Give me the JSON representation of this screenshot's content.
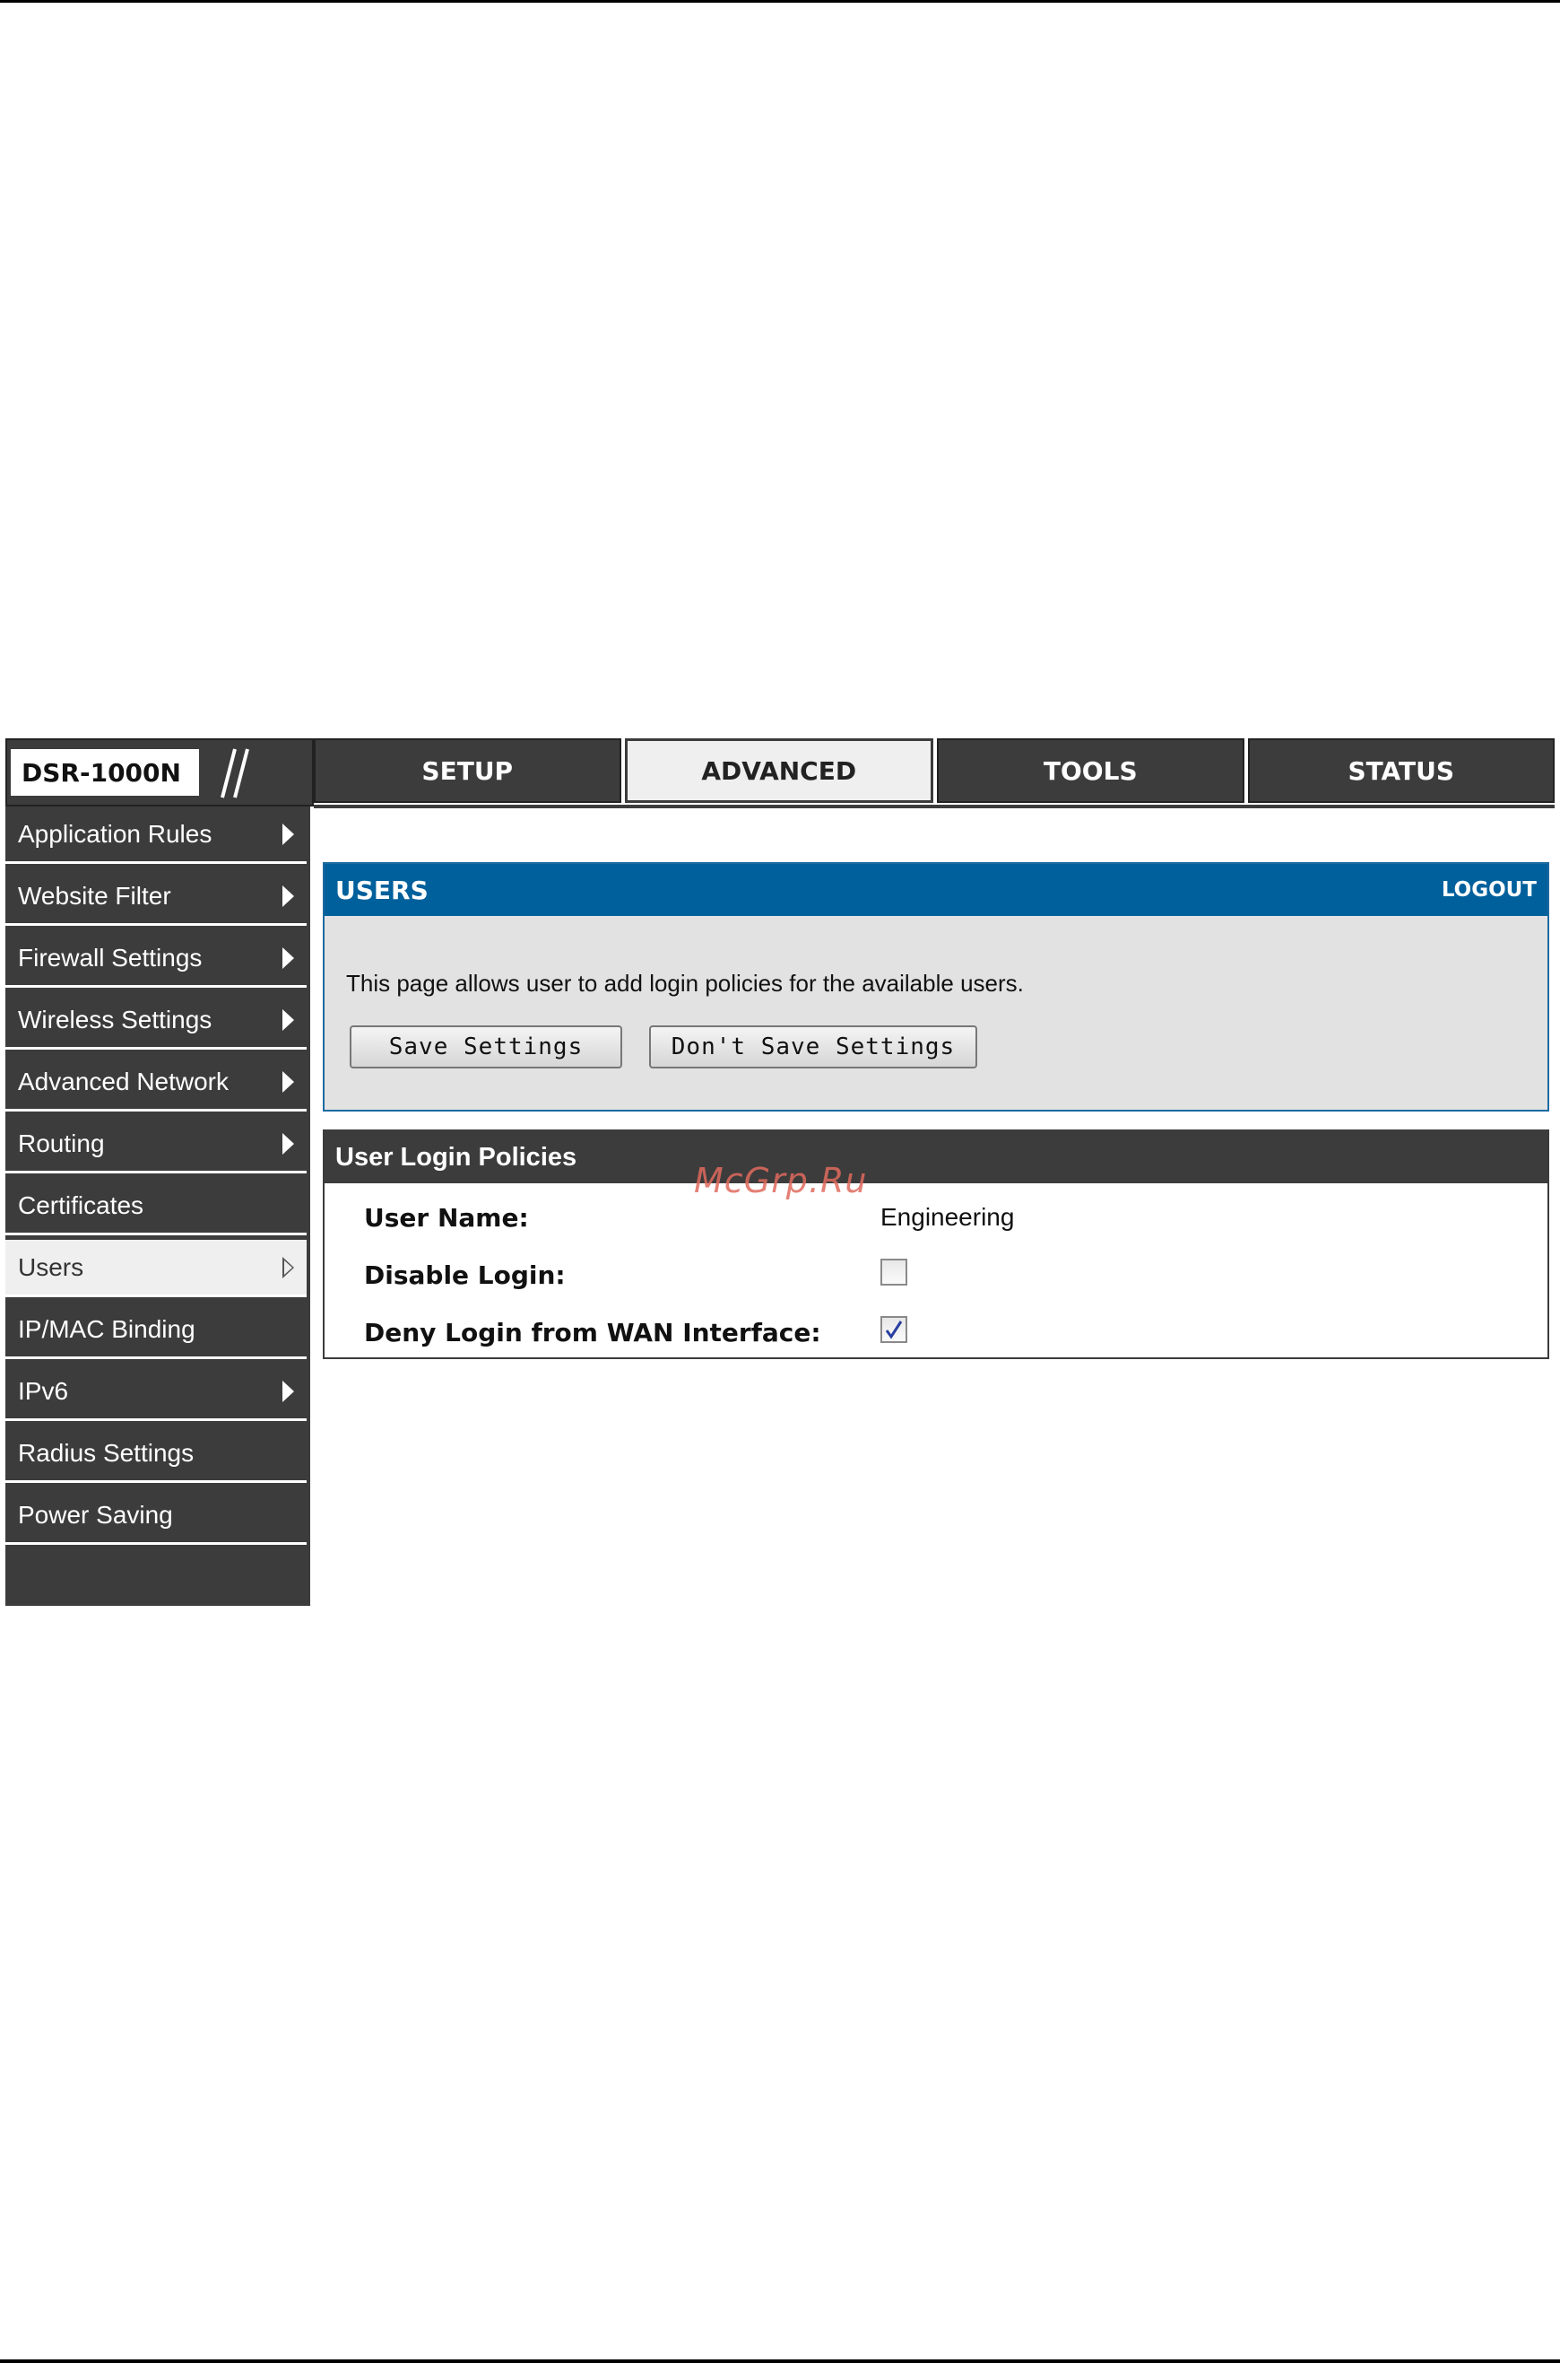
{
  "device": {
    "model": "DSR-1000N"
  },
  "tabs": [
    {
      "label": "SETUP",
      "active": false
    },
    {
      "label": "ADVANCED",
      "active": true
    },
    {
      "label": "TOOLS",
      "active": false
    },
    {
      "label": "STATUS",
      "active": false
    }
  ],
  "sidebar": {
    "items": [
      {
        "label": "Application Rules",
        "arrow": true
      },
      {
        "label": "Website Filter",
        "arrow": true
      },
      {
        "label": "Firewall Settings",
        "arrow": true
      },
      {
        "label": "Wireless Settings",
        "arrow": true
      },
      {
        "label": "Advanced Network",
        "arrow": true
      },
      {
        "label": "Routing",
        "arrow": true
      },
      {
        "label": "Certificates",
        "arrow": false
      },
      {
        "label": "Users",
        "arrow": true,
        "active": true
      },
      {
        "label": "IP/MAC Binding",
        "arrow": false
      },
      {
        "label": "IPv6",
        "arrow": true
      },
      {
        "label": "Radius Settings",
        "arrow": false
      },
      {
        "label": "Power Saving",
        "arrow": false
      }
    ]
  },
  "users_panel": {
    "title": "USERS",
    "logout": "LOGOUT",
    "description": "This page allows user to add login policies for the available users.",
    "save_button": "Save Settings",
    "dont_save_button": "Don't Save Settings"
  },
  "policies_panel": {
    "title": "User Login Policies",
    "user_name_label": "User Name:",
    "user_name_value": "Engineering",
    "disable_login_label": "Disable Login:",
    "disable_login_checked": false,
    "deny_wan_label": "Deny Login from WAN Interface:",
    "deny_wan_checked": true
  },
  "watermark": "McGrp.Ru",
  "colors": {
    "nav_dark": "#3c3c3c",
    "header_blue": "#00609c",
    "panel_gray": "#e2e2e2",
    "watermark": "#e06a5e"
  }
}
